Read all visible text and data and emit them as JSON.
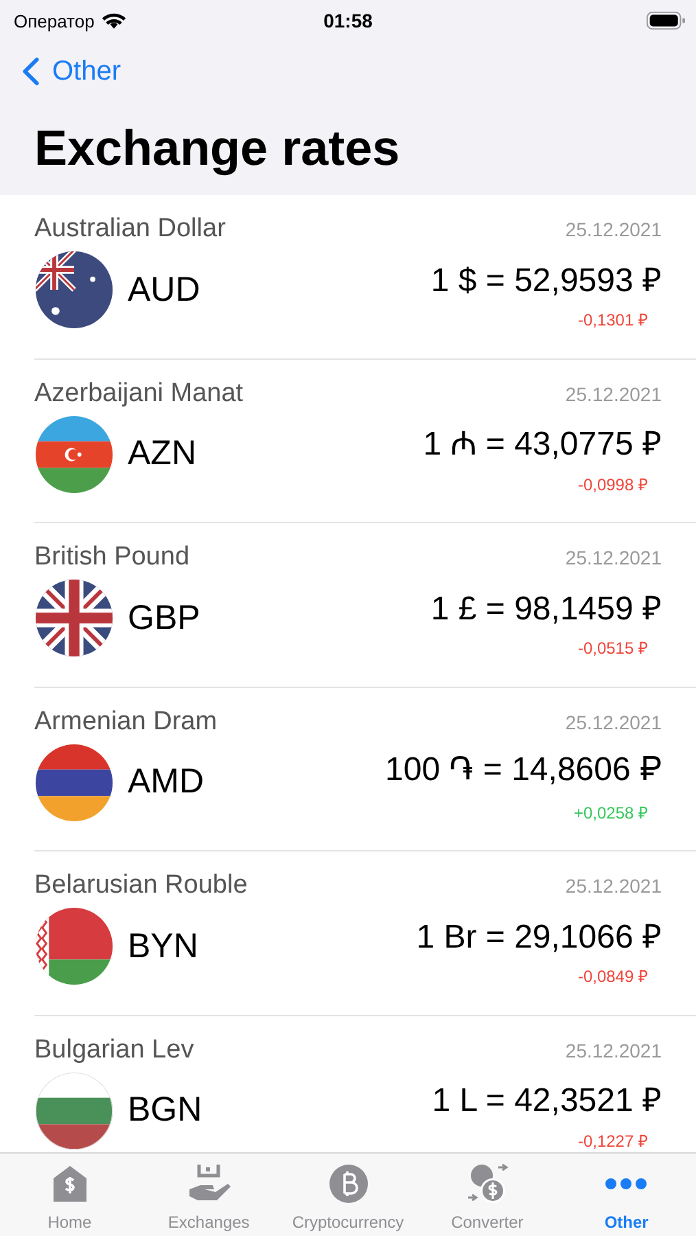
{
  "status_bar": {
    "carrier": "Оператор",
    "time": "01:58"
  },
  "nav": {
    "back": "Other",
    "title": "Exchange rates"
  },
  "rates": [
    {
      "name": "Australian Dollar",
      "date": "25.12.2021",
      "code": "AUD",
      "rate": "1 $ = 52,9593 ₽",
      "change": "-0,1301 ₽",
      "color": "#f0453a"
    },
    {
      "name": "Azerbaijani Manat",
      "date": "25.12.2021",
      "code": "AZN",
      "rate": "1 ₼ = 43,0775 ₽",
      "change": "-0,0998 ₽",
      "color": "#f0453a"
    },
    {
      "name": "British Pound",
      "date": "25.12.2021",
      "code": "GBP",
      "rate": "1 £ = 98,1459 ₽",
      "change": "-0,0515 ₽",
      "color": "#f0453a"
    },
    {
      "name": "Armenian Dram",
      "date": "25.12.2021",
      "code": "AMD",
      "rate": "100 ֏ = 14,8606 ₽",
      "change": "+0,0258 ₽",
      "color": "#34c759"
    },
    {
      "name": "Belarusian Rouble",
      "date": "25.12.2021",
      "code": "BYN",
      "rate": "1 Br = 29,1066 ₽",
      "change": "-0,0849 ₽",
      "color": "#f0453a"
    },
    {
      "name": "Bulgarian Lev",
      "date": "25.12.2021",
      "code": "BGN",
      "rate": "1 L = 42,3521 ₽",
      "change": "-0,1227 ₽",
      "color": "#f0453a"
    }
  ],
  "tabs": [
    {
      "label": "Home",
      "selected": false
    },
    {
      "label": "Exchanges",
      "selected": false
    },
    {
      "label": "Cryptocurrency",
      "selected": false
    },
    {
      "label": "Converter",
      "selected": false
    },
    {
      "label": "Other",
      "selected": true
    }
  ]
}
